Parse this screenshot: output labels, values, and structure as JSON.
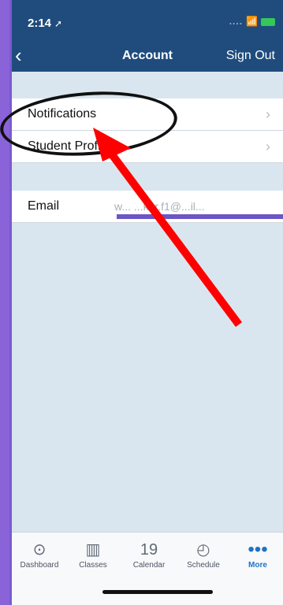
{
  "status": {
    "time": "2:14",
    "location_arrow": "➚",
    "wifi": "wifi-icon",
    "battery": "battery-icon"
  },
  "nav": {
    "back_symbol": "‹",
    "title": "Account",
    "sign_out": "Sign Out"
  },
  "rows": [
    {
      "label": "Notifications"
    },
    {
      "label": "Student Profiles"
    }
  ],
  "email": {
    "label": "Email",
    "value": "w... ...ker.f1@...il..."
  },
  "tabs": [
    {
      "label": "Dashboard",
      "icon": "⊙"
    },
    {
      "label": "Classes",
      "icon": "▥"
    },
    {
      "label": "Calendar",
      "icon": "19"
    },
    {
      "label": "Schedule",
      "icon": "◴"
    },
    {
      "label": "More",
      "icon": "•••"
    }
  ]
}
